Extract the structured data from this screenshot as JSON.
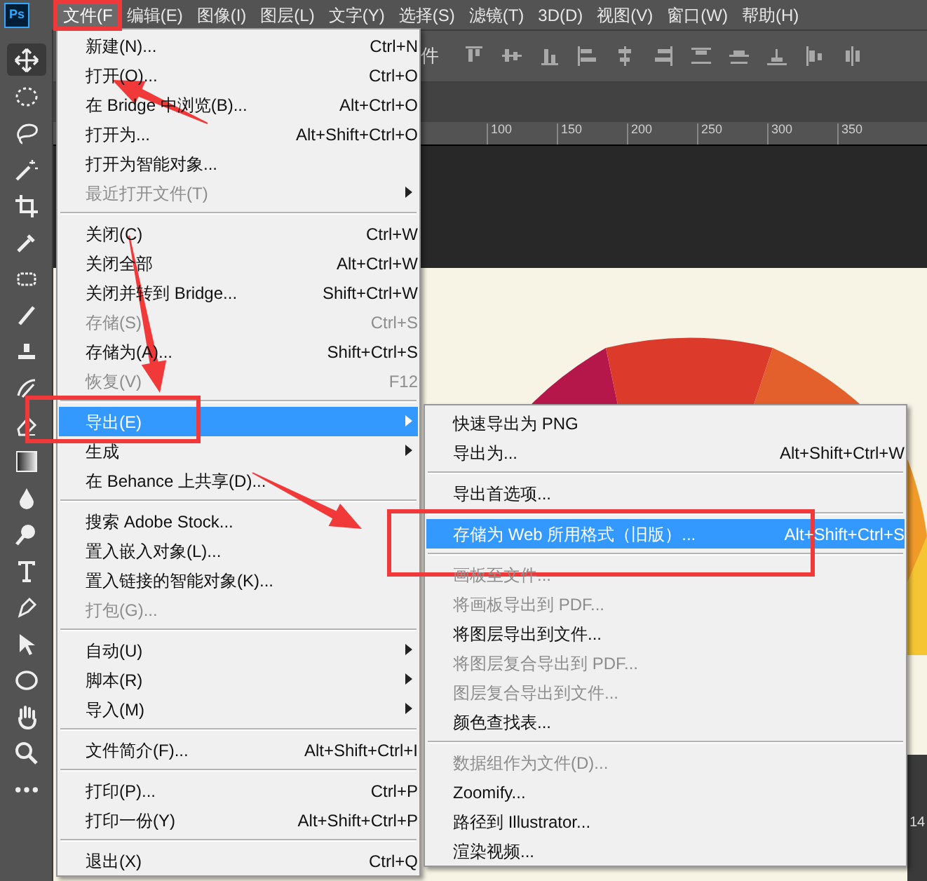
{
  "app_logo": "Ps",
  "menubar": [
    {
      "label": "文件(F",
      "selected": true
    },
    {
      "label": "编辑(E)",
      "selected": false
    },
    {
      "label": "图像(I)",
      "selected": false
    },
    {
      "label": "图层(L)",
      "selected": false
    },
    {
      "label": "文字(Y)",
      "selected": false
    },
    {
      "label": "选择(S)",
      "selected": false
    },
    {
      "label": "滤镜(T)",
      "selected": false
    },
    {
      "label": "3D(D)",
      "selected": false
    },
    {
      "label": "视图(V)",
      "selected": false
    },
    {
      "label": "窗口(W)",
      "selected": false
    },
    {
      "label": "帮助(H)",
      "selected": false
    }
  ],
  "options_bar": {
    "text_fragment": "件"
  },
  "ruler": {
    "labels": [
      "100",
      "150",
      "200",
      "250",
      "300",
      "350"
    ]
  },
  "side_panel": {
    "text_fragment": "14"
  },
  "file_menu": [
    {
      "kind": "item",
      "label": "新建(N)...",
      "shortcut": "Ctrl+N",
      "disabled": false,
      "has_submenu": false,
      "selected": false
    },
    {
      "kind": "item",
      "label": "打开(O)...",
      "shortcut": "Ctrl+O",
      "disabled": false,
      "has_submenu": false,
      "selected": false
    },
    {
      "kind": "item",
      "label": "在 Bridge 中浏览(B)...",
      "shortcut": "Alt+Ctrl+O",
      "disabled": false,
      "has_submenu": false,
      "selected": false
    },
    {
      "kind": "item",
      "label": "打开为...",
      "shortcut": "Alt+Shift+Ctrl+O",
      "disabled": false,
      "has_submenu": false,
      "selected": false
    },
    {
      "kind": "item",
      "label": "打开为智能对象...",
      "disabled": false,
      "has_submenu": false,
      "selected": false
    },
    {
      "kind": "item",
      "label": "最近打开文件(T)",
      "disabled": true,
      "has_submenu": true,
      "selected": false
    },
    {
      "kind": "separator"
    },
    {
      "kind": "item",
      "label": "关闭(C)",
      "shortcut": "Ctrl+W",
      "disabled": false,
      "has_submenu": false,
      "selected": false
    },
    {
      "kind": "item",
      "label": "关闭全部",
      "shortcut": "Alt+Ctrl+W",
      "disabled": false,
      "has_submenu": false,
      "selected": false
    },
    {
      "kind": "item",
      "label": "关闭并转到 Bridge...",
      "shortcut": "Shift+Ctrl+W",
      "disabled": false,
      "has_submenu": false,
      "selected": false
    },
    {
      "kind": "item",
      "label": "存储(S)",
      "shortcut": "Ctrl+S",
      "disabled": true,
      "has_submenu": false,
      "selected": false
    },
    {
      "kind": "item",
      "label": "存储为(A)...",
      "shortcut": "Shift+Ctrl+S",
      "disabled": false,
      "has_submenu": false,
      "selected": false
    },
    {
      "kind": "item",
      "label": "恢复(V)",
      "shortcut": "F12",
      "disabled": true,
      "has_submenu": false,
      "selected": false
    },
    {
      "kind": "separator"
    },
    {
      "kind": "item",
      "label": "导出(E)",
      "disabled": false,
      "has_submenu": true,
      "selected": true
    },
    {
      "kind": "item",
      "label": "生成",
      "disabled": false,
      "has_submenu": true,
      "selected": false
    },
    {
      "kind": "item",
      "label": "在 Behance 上共享(D)...",
      "disabled": false,
      "has_submenu": false,
      "selected": false
    },
    {
      "kind": "separator"
    },
    {
      "kind": "item",
      "label": "搜索 Adobe Stock...",
      "disabled": false,
      "has_submenu": false,
      "selected": false
    },
    {
      "kind": "item",
      "label": "置入嵌入对象(L)...",
      "disabled": false,
      "has_submenu": false,
      "selected": false
    },
    {
      "kind": "item",
      "label": "置入链接的智能对象(K)...",
      "disabled": false,
      "has_submenu": false,
      "selected": false
    },
    {
      "kind": "item",
      "label": "打包(G)...",
      "disabled": true,
      "has_submenu": false,
      "selected": false
    },
    {
      "kind": "separator"
    },
    {
      "kind": "item",
      "label": "自动(U)",
      "disabled": false,
      "has_submenu": true,
      "selected": false
    },
    {
      "kind": "item",
      "label": "脚本(R)",
      "disabled": false,
      "has_submenu": true,
      "selected": false
    },
    {
      "kind": "item",
      "label": "导入(M)",
      "disabled": false,
      "has_submenu": true,
      "selected": false
    },
    {
      "kind": "separator"
    },
    {
      "kind": "item",
      "label": "文件简介(F)...",
      "shortcut": "Alt+Shift+Ctrl+I",
      "disabled": false,
      "has_submenu": false,
      "selected": false
    },
    {
      "kind": "separator"
    },
    {
      "kind": "item",
      "label": "打印(P)...",
      "shortcut": "Ctrl+P",
      "disabled": false,
      "has_submenu": false,
      "selected": false
    },
    {
      "kind": "item",
      "label": "打印一份(Y)",
      "shortcut": "Alt+Shift+Ctrl+P",
      "disabled": false,
      "has_submenu": false,
      "selected": false
    },
    {
      "kind": "separator"
    },
    {
      "kind": "item",
      "label": "退出(X)",
      "shortcut": "Ctrl+Q",
      "disabled": false,
      "has_submenu": false,
      "selected": false
    }
  ],
  "export_submenu": [
    {
      "kind": "item",
      "label": "快速导出为 PNG",
      "disabled": false,
      "selected": false
    },
    {
      "kind": "item",
      "label": "导出为...",
      "shortcut": "Alt+Shift+Ctrl+W",
      "disabled": false,
      "selected": false
    },
    {
      "kind": "separator"
    },
    {
      "kind": "item",
      "label": "导出首选项...",
      "disabled": false,
      "selected": false
    },
    {
      "kind": "separator"
    },
    {
      "kind": "item",
      "label": "存储为 Web 所用格式（旧版）...",
      "shortcut": "Alt+Shift+Ctrl+S",
      "disabled": false,
      "selected": true
    },
    {
      "kind": "separator"
    },
    {
      "kind": "item",
      "label": "画板至文件...",
      "disabled": true,
      "selected": false
    },
    {
      "kind": "item",
      "label": "将画板导出到 PDF...",
      "disabled": true,
      "selected": false
    },
    {
      "kind": "item",
      "label": "将图层导出到文件...",
      "disabled": false,
      "selected": false
    },
    {
      "kind": "item",
      "label": "将图层复合导出到 PDF...",
      "disabled": true,
      "selected": false
    },
    {
      "kind": "item",
      "label": "图层复合导出到文件...",
      "disabled": true,
      "selected": false
    },
    {
      "kind": "item",
      "label": "颜色查找表...",
      "disabled": false,
      "selected": false
    },
    {
      "kind": "separator"
    },
    {
      "kind": "item",
      "label": "数据组作为文件(D)...",
      "disabled": true,
      "selected": false
    },
    {
      "kind": "item",
      "label": "Zoomify...",
      "disabled": false,
      "selected": false
    },
    {
      "kind": "item",
      "label": "路径到 Illustrator...",
      "disabled": false,
      "selected": false
    },
    {
      "kind": "item",
      "label": "渲染视频...",
      "disabled": false,
      "selected": false
    }
  ]
}
